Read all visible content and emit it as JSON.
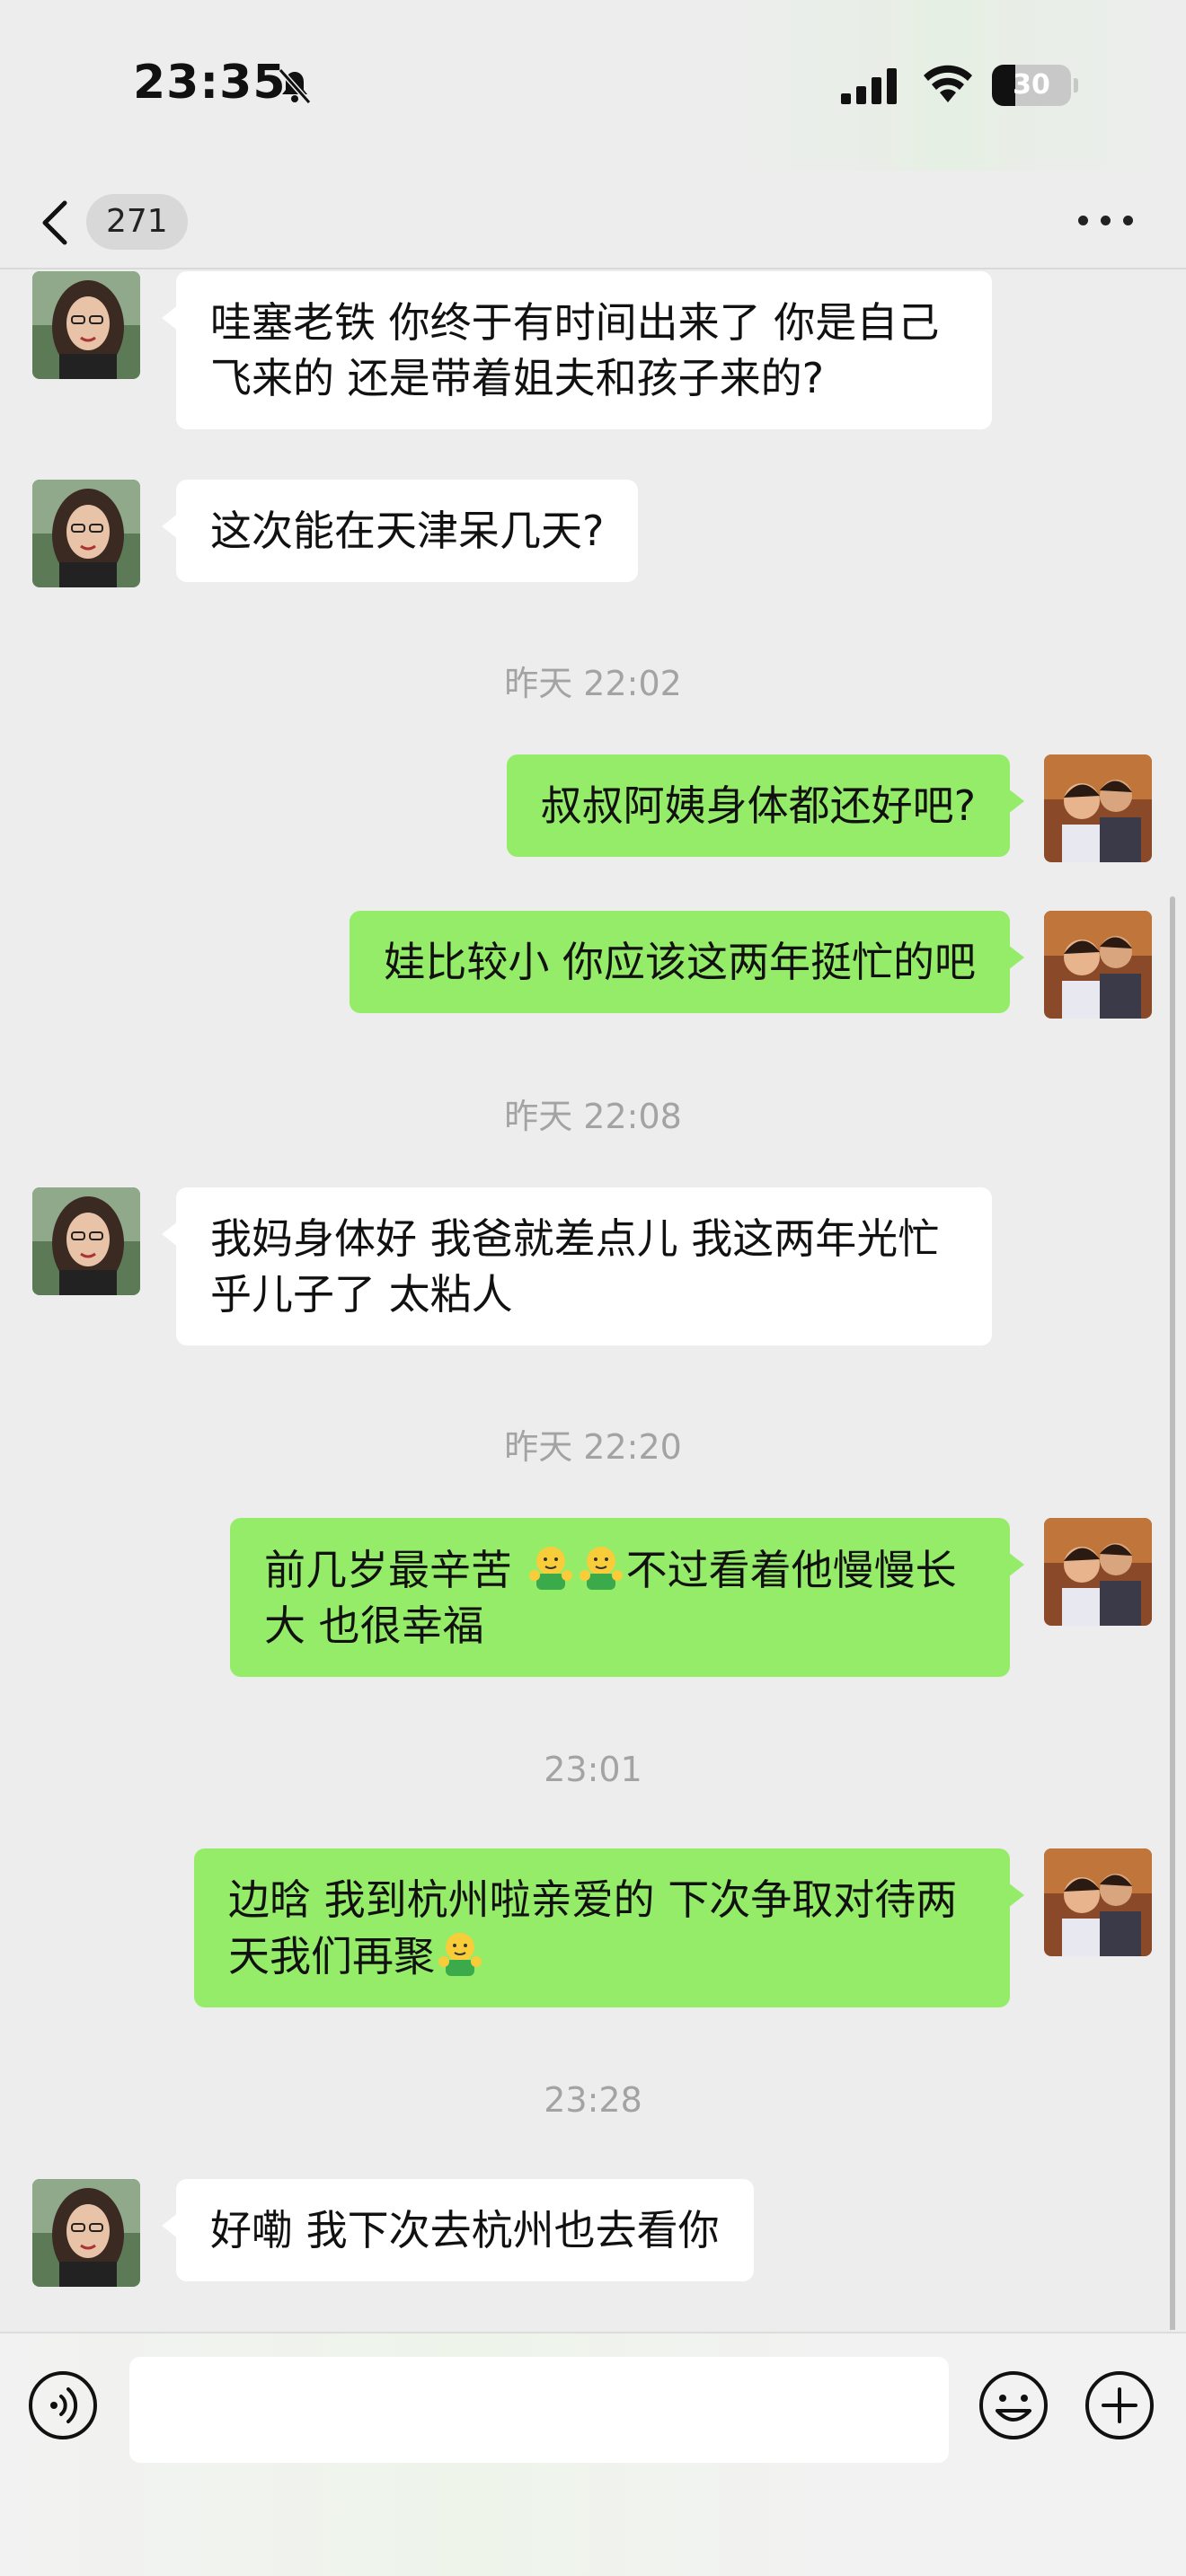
{
  "status_bar": {
    "time": "23:35",
    "battery_text": "30",
    "battery_level": 0.3,
    "icons": [
      "bell-muted-icon",
      "cellular-signal-icon",
      "wifi-icon",
      "battery-icon"
    ]
  },
  "nav": {
    "unread_count": "271",
    "back_icon": "chevron-left-icon",
    "more_icon": "ellipsis-icon"
  },
  "messages": [
    {
      "side": "in",
      "text": "哇塞老铁 你终于有时间出来了 你是自己飞来的 还是带着姐夫和孩子来的?"
    },
    {
      "side": "in",
      "text": "这次能在天津呆几天?"
    },
    {
      "timestamp": "昨天 22:02"
    },
    {
      "side": "out",
      "text": "叔叔阿姨身体都还好吧?"
    },
    {
      "side": "out",
      "text": "娃比较小 你应该这两年挺忙的吧"
    },
    {
      "timestamp": "昨天 22:08"
    },
    {
      "side": "in",
      "text": "我妈身体好 我爸就差点儿 我这两年光忙乎儿子了 太粘人"
    },
    {
      "timestamp": "昨天 22:20"
    },
    {
      "side": "out",
      "text_before": "前几岁最辛苦 ",
      "emoji_count": 2,
      "emoji_name": "hug-emoji",
      "text_after": "不过看着他慢慢长大 也很幸福"
    },
    {
      "timestamp": "23:01"
    },
    {
      "side": "out",
      "text_before": "边晗 我到杭州啦亲爱的 下次争取对待两天我们再聚",
      "emoji_count": 1,
      "emoji_name": "hug-emoji",
      "text_after": ""
    },
    {
      "timestamp": "23:28"
    },
    {
      "side": "in",
      "text": "好嘞 我下次去杭州也去看你"
    }
  ],
  "input_bar": {
    "voice_icon": "voice-icon",
    "emoji_icon": "emoji-icon",
    "plus_icon": "plus-icon",
    "input_value": ""
  },
  "colors": {
    "background": "#ededed",
    "incoming_bubble": "#ffffff",
    "outgoing_bubble": "#95ec69",
    "timestamp": "#a3a3a3"
  }
}
